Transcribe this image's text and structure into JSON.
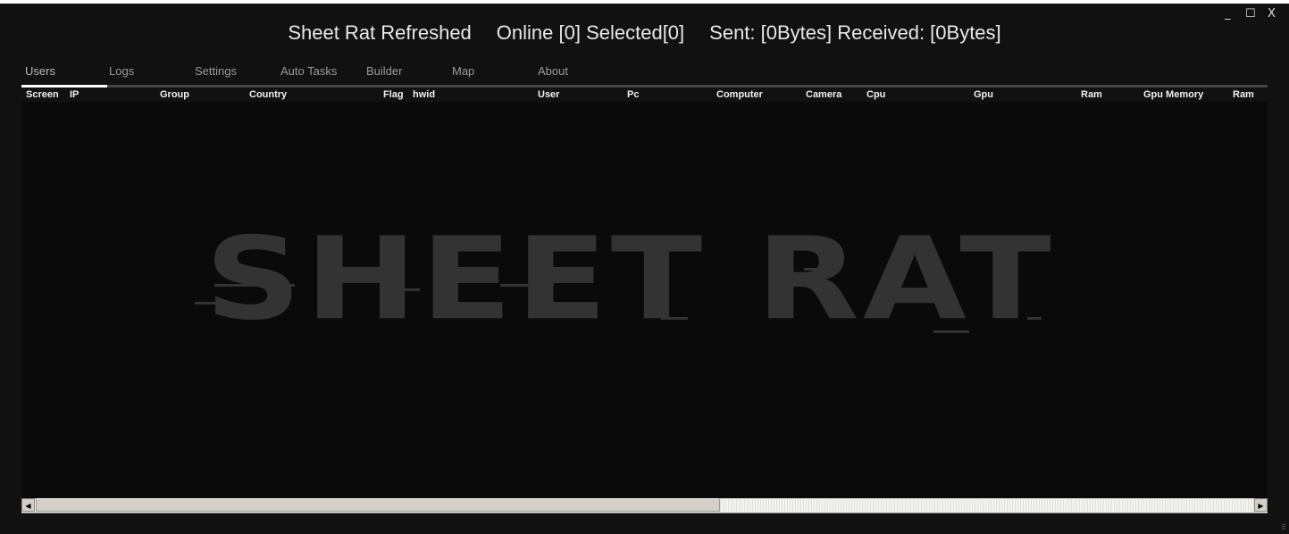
{
  "window": {
    "title": "Sheet Rat Refreshed",
    "status": {
      "online": "Online [0] Selected[0]",
      "traffic": "Sent: [0Bytes] Received: [0Bytes]"
    },
    "controls": {
      "minimize": "_",
      "maximize": "☐",
      "close": "X"
    }
  },
  "tabs": [
    {
      "label": "Users",
      "active": true
    },
    {
      "label": "Logs"
    },
    {
      "label": "Settings"
    },
    {
      "label": "Auto Tasks"
    },
    {
      "label": "Builder"
    },
    {
      "label": "Map"
    },
    {
      "label": "About"
    }
  ],
  "table": {
    "columns": [
      "Screen",
      "IP",
      "Group",
      "Country",
      "Flag",
      "hwid",
      "User",
      "Pc",
      "Computer",
      "Camera",
      "Cpu",
      "Gpu",
      "Ram",
      "Gpu Memory",
      "Ram"
    ],
    "rows": []
  },
  "watermark": {
    "text": "SHEET RAT"
  },
  "scrollbar": {
    "left_arrow": "◀",
    "right_arrow": "▶",
    "position": 0
  }
}
